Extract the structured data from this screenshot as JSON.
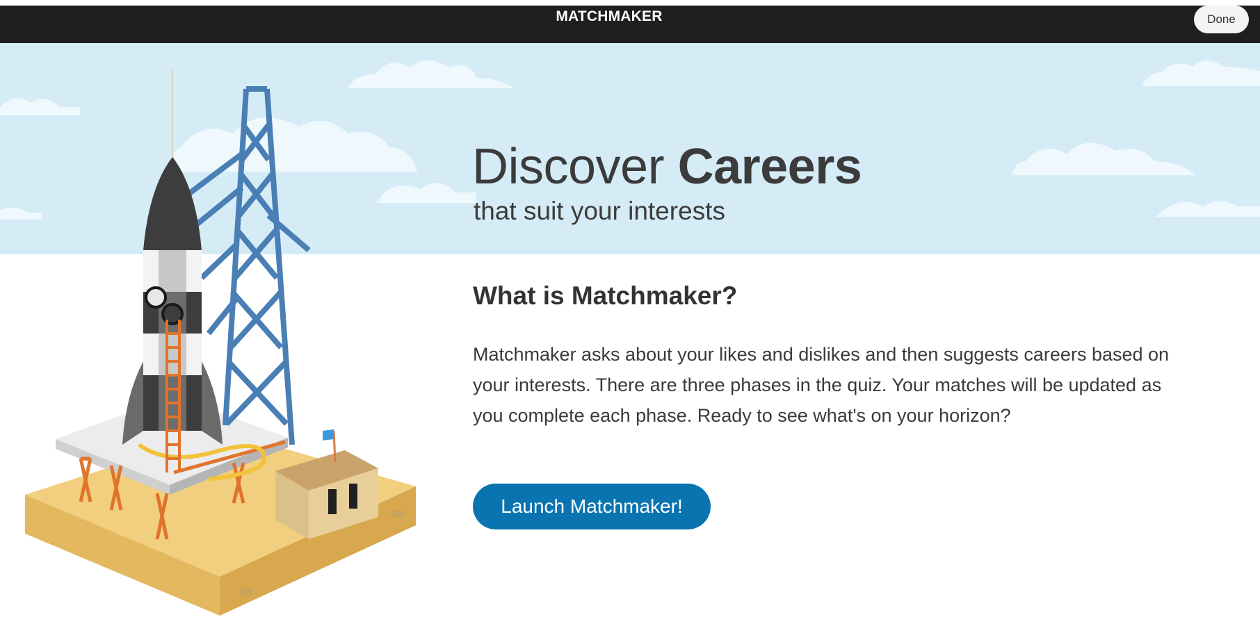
{
  "navbar": {
    "brand": "MATCHMAKER",
    "done_label": "Done"
  },
  "hero": {
    "title_light": "Discover",
    "title_bold": "Careers",
    "subtitle": "that suit your interests"
  },
  "intro": {
    "heading": "What is Matchmaker?",
    "description": "Matchmaker asks about your likes and dislikes and then suggests careers based on your interests. There are three phases in the quiz. Your matches will be updated as you complete each phase. Ready to see what's on your horizon?",
    "launch_label": "Launch Matchmaker!"
  },
  "colors": {
    "navbar": "#1f1f1f",
    "sky": "#d5ecf7",
    "accent": "#0a74b0",
    "tower": "#4a7fb5",
    "sand": "#f2cf7e"
  },
  "illustration": {
    "name": "rocket-launch-pad-illustration"
  }
}
